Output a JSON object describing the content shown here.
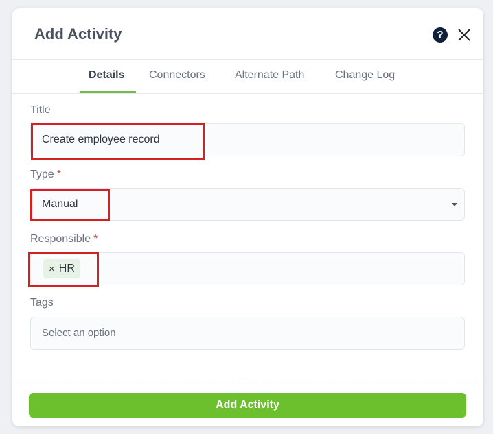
{
  "modal": {
    "title": "Add Activity",
    "help_icon": "question-circle-icon",
    "close_icon": "close-icon"
  },
  "tabs": [
    {
      "label": "Details",
      "active": true
    },
    {
      "label": "Connectors",
      "active": false
    },
    {
      "label": "Alternate Path",
      "active": false
    },
    {
      "label": "Change Log",
      "active": false
    }
  ],
  "form": {
    "title": {
      "label": "Title",
      "value": "Create employee record"
    },
    "type": {
      "label": "Type",
      "required_mark": "*",
      "value": "Manual"
    },
    "responsible": {
      "label": "Responsible",
      "required_mark": "*",
      "chips": [
        {
          "label": "HR",
          "remove": "×"
        }
      ]
    },
    "tags": {
      "label": "Tags",
      "placeholder": "Select an option"
    }
  },
  "footer": {
    "submit_label": "Add Activity"
  },
  "colors": {
    "accent": "#6cc02e",
    "highlight": "#d42020",
    "required": "#e04848"
  }
}
